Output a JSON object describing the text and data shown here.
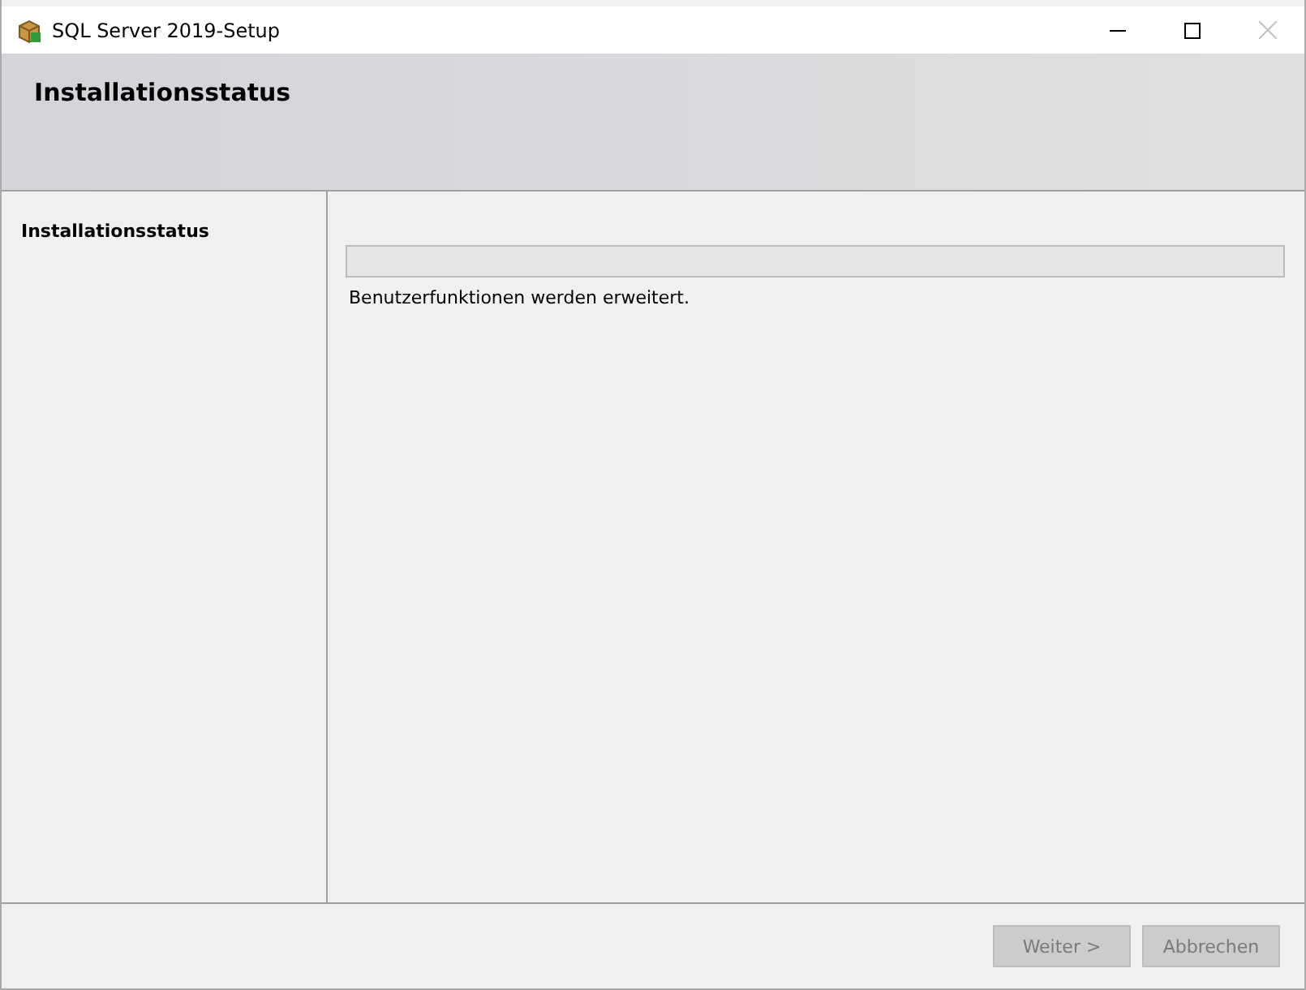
{
  "window": {
    "title": "SQL Server 2019-Setup",
    "close_disabled": true
  },
  "header": {
    "title": "Installationsstatus"
  },
  "sidebar": {
    "items": [
      {
        "label": "Installationsstatus",
        "selected": true
      }
    ]
  },
  "progress": {
    "level": 0,
    "message": "Benutzerfunktionen werden erweitert."
  },
  "buttons": [
    {
      "label": "Weiter >",
      "disabled": true
    },
    {
      "label": "Abbrechen",
      "disabled": true
    }
  ]
}
